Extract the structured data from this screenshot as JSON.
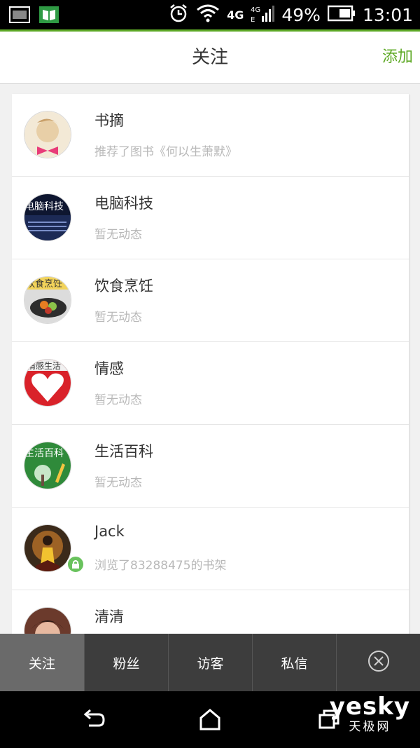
{
  "status_bar": {
    "network": "4G",
    "battery": "49%",
    "time": "13:01"
  },
  "header": {
    "title": "关注",
    "action_label": "添加"
  },
  "follow_list": [
    {
      "name": "书摘",
      "status": "推荐了图书《何以生萧默》",
      "avatar_text": ""
    },
    {
      "name": "电脑科技",
      "status": "暂无动态",
      "avatar_text": "电脑科技"
    },
    {
      "name": "饮食烹饪",
      "status": "暂无动态",
      "avatar_text": "饮食烹饪"
    },
    {
      "name": "情感",
      "status": "暂无动态",
      "avatar_text": "情感生活"
    },
    {
      "name": "生活百科",
      "status": "暂无动态",
      "avatar_text": "生活百科"
    },
    {
      "name": "Jack",
      "status": "浏览了83288475的书架",
      "avatar_text": ""
    },
    {
      "name": "清清",
      "status": "",
      "avatar_text": ""
    }
  ],
  "tabs": [
    "关注",
    "粉丝",
    "访客",
    "私信"
  ],
  "active_tab": "关注",
  "watermark": {
    "line1": "yesky",
    "line2": "天极网"
  },
  "colors": {
    "accent": "#5ea926",
    "tab_bg": "#3d3d3d",
    "tab_active": "#6a6a6a",
    "lock": "#69c25d"
  }
}
